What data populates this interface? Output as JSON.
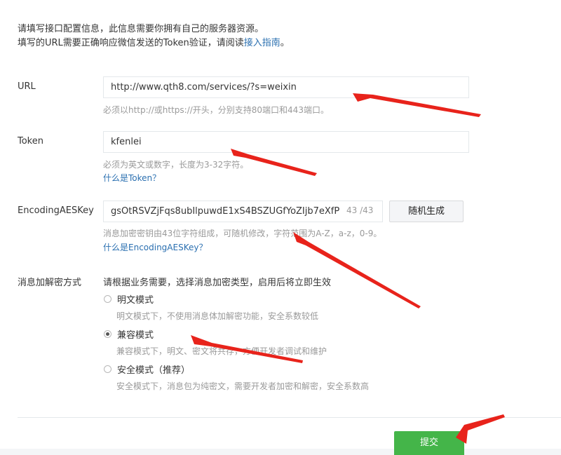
{
  "intro": {
    "line1": "请填写接口配置信息，此信息需要你拥有自己的服务器资源。",
    "line2_prefix": "填写的URL需要正确响应微信发送的Token验证，请阅读",
    "line2_link": "接入指南",
    "line2_suffix": "。"
  },
  "url": {
    "label": "URL",
    "value": "http://www.qth8.com/services/?s=weixin",
    "tip": "必须以http://或https://开头，分别支持80端口和443端口。"
  },
  "token": {
    "label": "Token",
    "value": "kfenlei",
    "tip": "必须为英文或数字，长度为3-32字符。",
    "help_link": "什么是Token？"
  },
  "aes": {
    "label": "EncodingAESKey",
    "value": "gsOtRSVZjFqs8ubIlpuwdE1xS4BSZUGfYoZIjb7eXfP",
    "counter": "43 /43",
    "generate_button": "随机生成",
    "tip": "消息加密密钥由43位字符组成，可随机修改，字符范围为A-Z，a-z，0-9。",
    "help_link": "什么是EncodingAESKey？"
  },
  "encryption": {
    "label": "消息加解密方式",
    "description": "请根据业务需要，选择消息加密类型，启用后将立即生效",
    "options": [
      {
        "label": "明文模式",
        "desc": "明文模式下，不使用消息体加解密功能，安全系数较低",
        "checked": false
      },
      {
        "label": "兼容模式",
        "desc": "兼容模式下，明文、密文将共存，方便开发者调试和维护",
        "checked": true
      },
      {
        "label": "安全模式（推荐）",
        "desc": "安全模式下，消息包为纯密文，需要开发者加密和解密，安全系数高",
        "checked": false
      }
    ]
  },
  "submit_button": "提交",
  "colors": {
    "accent_green": "#44b549",
    "link_blue": "#2a6fb0",
    "annotation_red": "#e8231b"
  }
}
